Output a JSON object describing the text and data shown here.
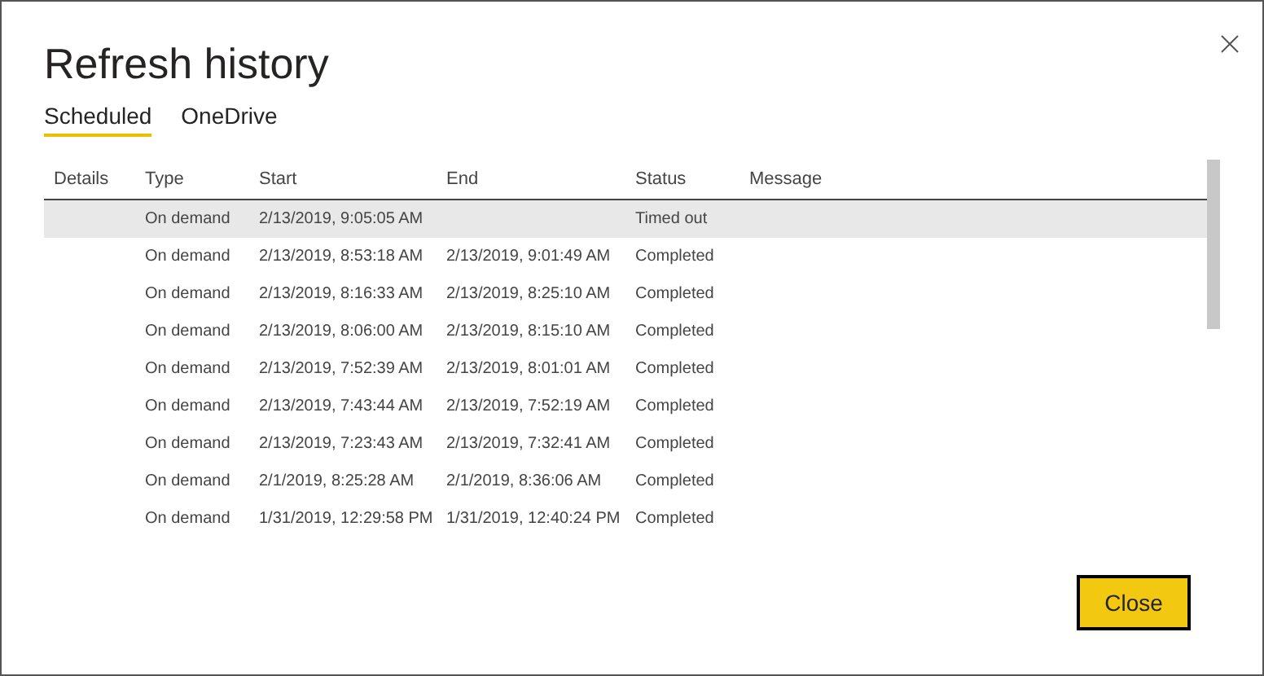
{
  "dialog": {
    "title": "Refresh history"
  },
  "tabs": [
    {
      "label": "Scheduled",
      "selected": true
    },
    {
      "label": "OneDrive",
      "selected": false
    }
  ],
  "table": {
    "columns": [
      "Details",
      "Type",
      "Start",
      "End",
      "Status",
      "Message"
    ],
    "rows": [
      {
        "selected": true,
        "cells": [
          "",
          "On demand",
          "2/13/2019, 9:05:05 AM",
          "",
          "Timed out",
          ""
        ]
      },
      {
        "selected": false,
        "cells": [
          "",
          "On demand",
          "2/13/2019, 8:53:18 AM",
          "2/13/2019, 9:01:49 AM",
          "Completed",
          ""
        ]
      },
      {
        "selected": false,
        "cells": [
          "",
          "On demand",
          "2/13/2019, 8:16:33 AM",
          "2/13/2019, 8:25:10 AM",
          "Completed",
          ""
        ]
      },
      {
        "selected": false,
        "cells": [
          "",
          "On demand",
          "2/13/2019, 8:06:00 AM",
          "2/13/2019, 8:15:10 AM",
          "Completed",
          ""
        ]
      },
      {
        "selected": false,
        "cells": [
          "",
          "On demand",
          "2/13/2019, 7:52:39 AM",
          "2/13/2019, 8:01:01 AM",
          "Completed",
          ""
        ]
      },
      {
        "selected": false,
        "cells": [
          "",
          "On demand",
          "2/13/2019, 7:43:44 AM",
          "2/13/2019, 7:52:19 AM",
          "Completed",
          ""
        ]
      },
      {
        "selected": false,
        "cells": [
          "",
          "On demand",
          "2/13/2019, 7:23:43 AM",
          "2/13/2019, 7:32:41 AM",
          "Completed",
          ""
        ]
      },
      {
        "selected": false,
        "cells": [
          "",
          "On demand",
          "2/1/2019, 8:25:28 AM",
          "2/1/2019, 8:36:06 AM",
          "Completed",
          ""
        ]
      },
      {
        "selected": false,
        "cells": [
          "",
          "On demand",
          "1/31/2019, 12:29:58 PM",
          "1/31/2019, 12:40:24 PM",
          "Completed",
          ""
        ]
      }
    ]
  },
  "buttons": [
    {
      "label": "Close"
    }
  ]
}
